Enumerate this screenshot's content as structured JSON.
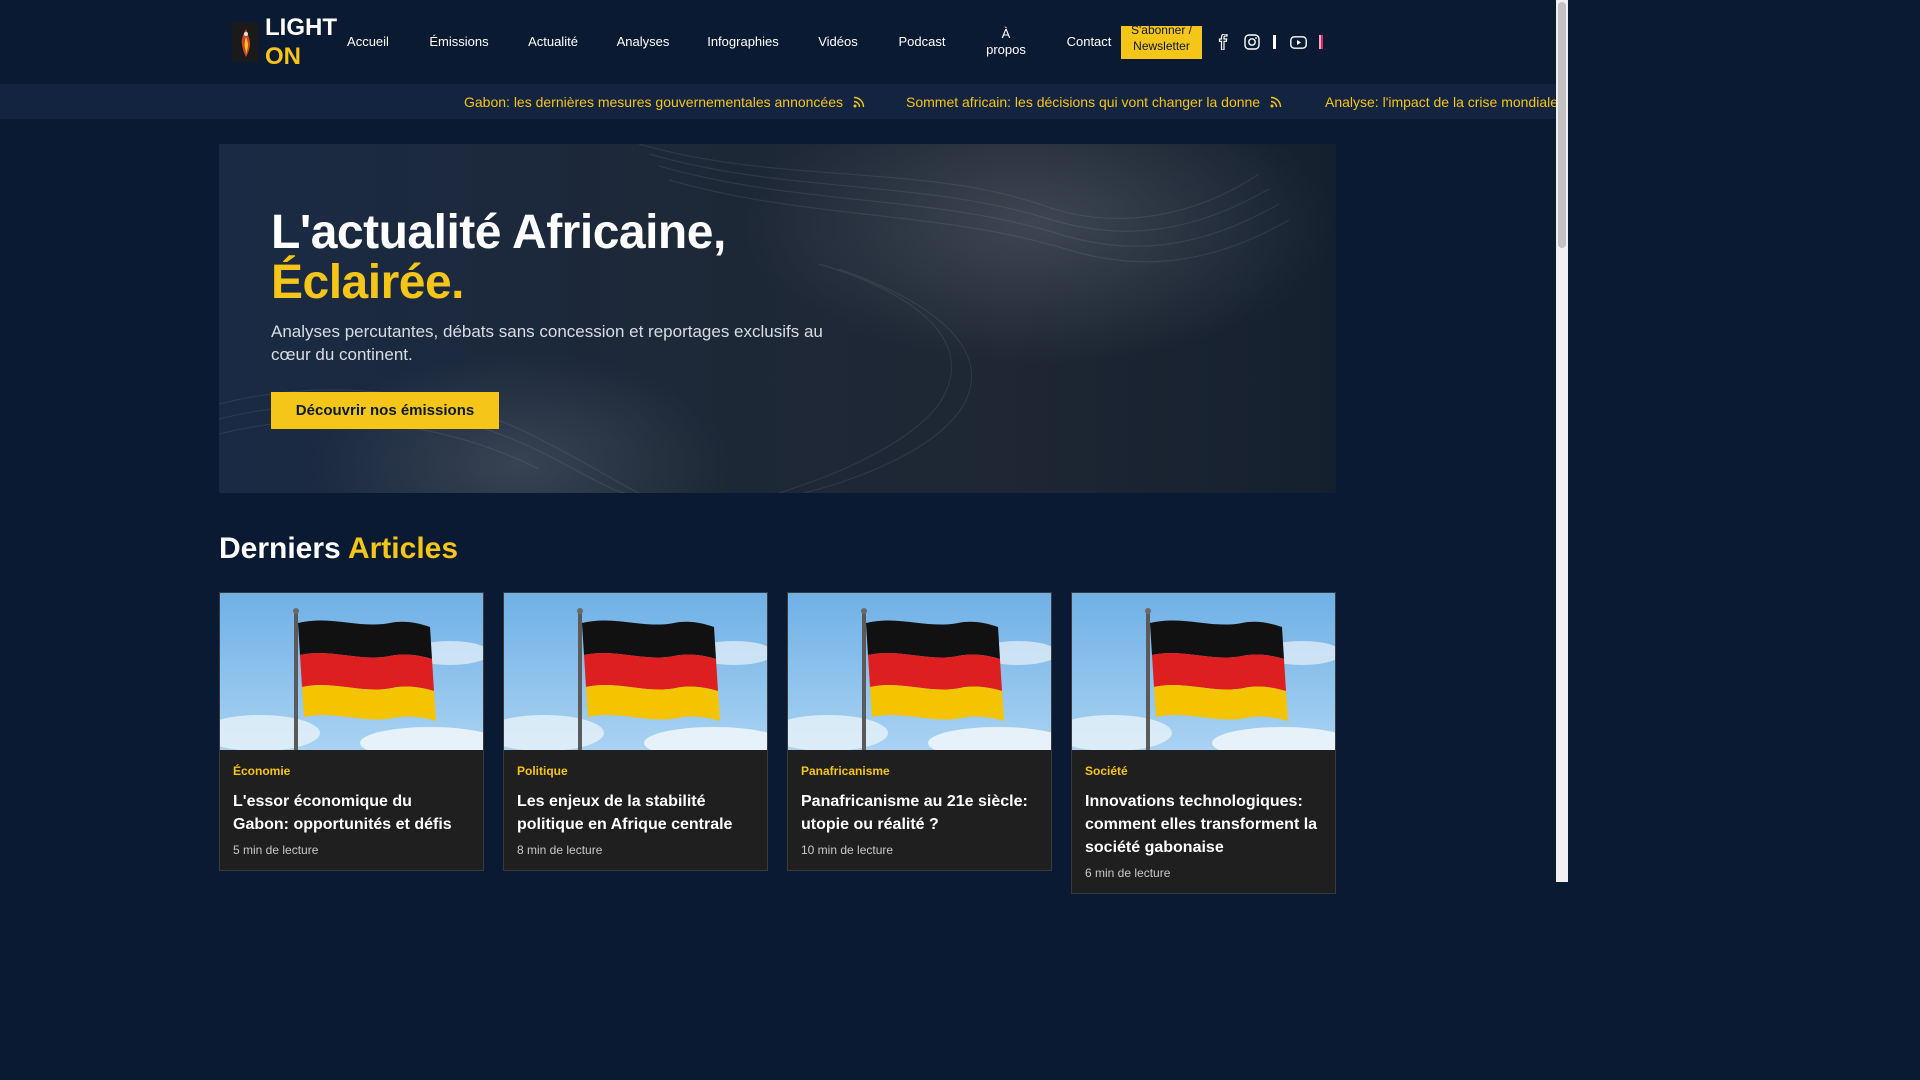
{
  "header": {
    "logo": {
      "line1": "LIGHT",
      "line2": "ON"
    },
    "nav": [
      {
        "label": "Accueil"
      },
      {
        "label": "Émissions"
      },
      {
        "label": "Actualité"
      },
      {
        "label": "Analyses"
      },
      {
        "label": "Infographies"
      },
      {
        "label": "Vidéos"
      },
      {
        "label": "Podcast"
      },
      {
        "label": "À propos"
      },
      {
        "label": "Contact"
      }
    ],
    "subscribe_label": "S'abonner / Newsletter",
    "social": [
      "facebook-icon",
      "instagram-icon",
      "x-icon",
      "youtube-icon",
      "tiktok-icon"
    ]
  },
  "ticker": [
    {
      "text": "Gabon: les dernières mesures gouvernementales annoncées"
    },
    {
      "text": "Sommet africain: les décisions qui vont changer la donne"
    },
    {
      "text": "Analyse: l'impact de la crise mondiale su"
    }
  ],
  "hero": {
    "title_line1": "L'actualité Africaine,",
    "title_line2": "Éclairée.",
    "subtitle": "Analyses percutantes, débats sans concession et reportages exclusifs au cœur du continent.",
    "cta_label": "Découvrir nos émissions"
  },
  "articles_section": {
    "title_part1": "Derniers",
    "title_part2": "Articles"
  },
  "articles": [
    {
      "category": "Économie",
      "title": "L'essor économique du Gabon: opportunités et défis",
      "meta": "5 min de lecture"
    },
    {
      "category": "Politique",
      "title": "Les enjeux de la stabilité politique en Afrique centrale",
      "meta": "8 min de lecture"
    },
    {
      "category": "Panafricanisme",
      "title": "Panafricanisme au 21e siècle: utopie ou réalité ?",
      "meta": "10 min de lecture"
    },
    {
      "category": "Société",
      "title": "Innovations technologiques: comment elles transforment la société gabonaise",
      "meta": "6 min de lecture"
    }
  ],
  "colors": {
    "background": "#0b1a33",
    "accent": "#f5c518",
    "card": "#1f1f1f"
  }
}
